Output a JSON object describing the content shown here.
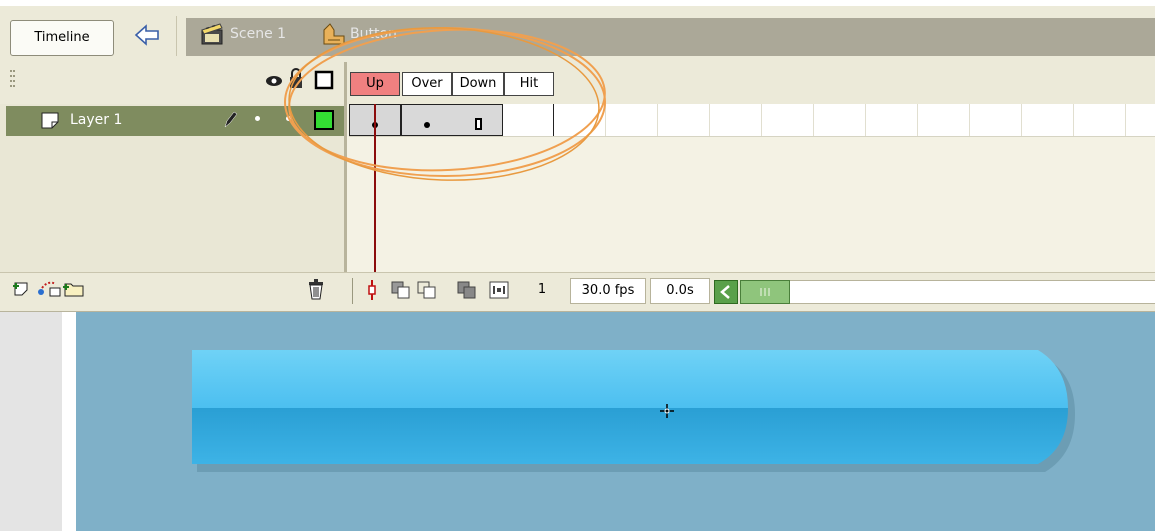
{
  "toolbar": {
    "timeline_label": "Timeline",
    "scene_label": "Scene 1",
    "symbol_label": "Button"
  },
  "frame_labels": [
    "Up",
    "Over",
    "Down",
    "Hit"
  ],
  "layer": {
    "name": "Layer 1"
  },
  "status": {
    "current_frame": "1",
    "frame_rate": "30.0 fps",
    "elapsed_time": "0.0s"
  },
  "colors": {
    "accent_frame": "#f08080",
    "layer_highlight": "#7f8c5f",
    "outline_swatch": "#33dd33",
    "annotation": "#f0a050",
    "button_fill_top": "#5cc8f0",
    "button_fill_bottom": "#2e9fd6",
    "stage": "#7fb0c8"
  }
}
